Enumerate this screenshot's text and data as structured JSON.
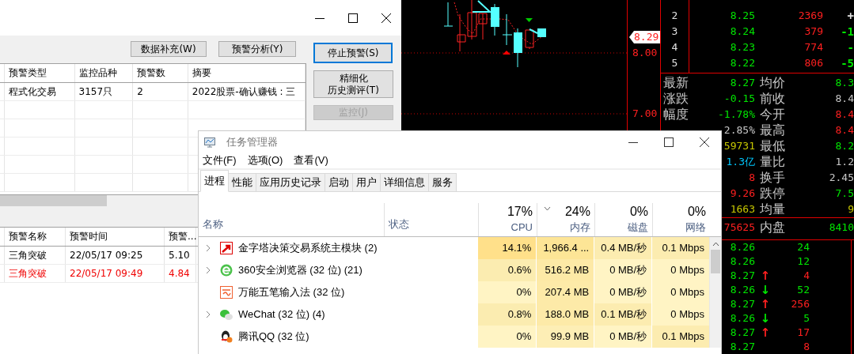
{
  "alert_window": {
    "toolbar_buttons": [
      "数据补充(W)",
      "预警分析(Y)"
    ],
    "strategy_table": {
      "columns": [
        "预警类型",
        "监控品种",
        "预警数",
        "摘要"
      ],
      "rows": [
        [
          "程式化交易",
          "3157只",
          "2",
          "2022股票-确认赚钱 : 三"
        ]
      ]
    },
    "side_buttons": [
      {
        "label": "停止预警(S)",
        "focused": true,
        "disabled": false
      },
      {
        "label": [
          "精细化",
          "历史测评(T)"
        ],
        "focused": false,
        "disabled": false
      },
      {
        "label": "监控(J)",
        "focused": false,
        "disabled": true
      }
    ],
    "alert_table": {
      "columns": [
        "预警名称",
        "预警时间",
        "预警..."
      ],
      "rows": [
        {
          "cells": [
            "三角突破",
            "22/05/17 09:25",
            "5.10"
          ],
          "highlighted": false
        },
        {
          "cells": [
            "三角突破",
            "22/05/17 09:49",
            "4.84"
          ],
          "highlighted": true
        }
      ]
    }
  },
  "stock_app": {
    "price_axis": [
      {
        "label": "8.29",
        "kind": "current"
      },
      {
        "label": "8.00",
        "kind": "tick"
      },
      {
        "label": "7.00",
        "kind": "tick"
      }
    ],
    "order_book": [
      {
        "index": "2",
        "price": "8.25",
        "volume": "2369",
        "change": {
          "text": "+",
          "color": "#e0e0e0"
        }
      },
      {
        "index": "3",
        "price": "8.24",
        "volume": "379",
        "change": {
          "text": "-1",
          "color": "#00e600"
        }
      },
      {
        "index": "4",
        "price": "8.23",
        "volume": "774",
        "change": {
          "text": "-",
          "color": "#00e600"
        }
      },
      {
        "index": "5",
        "price": "8.22",
        "volume": "806",
        "change": {
          "text": "-5",
          "color": "#00e600"
        }
      }
    ],
    "quote_stats": [
      {
        "label": "最新",
        "value": {
          "text": "8.27",
          "color": "#00e600"
        },
        "label_2": "均价",
        "value_2": {
          "text": "8.3",
          "color": "#00e600"
        }
      },
      {
        "label": "涨跌",
        "value": {
          "text": "-0.15",
          "color": "#00e600"
        },
        "label_2": "前收",
        "value_2": {
          "text": "8.4",
          "color": "#c8c8c8"
        }
      },
      {
        "label": "幅度",
        "value": {
          "text": "-1.78%",
          "color": "#00e600"
        },
        "label_2": "今开",
        "value_2": {
          "text": "8.4",
          "color": "#ff2020"
        }
      },
      {
        "value": {
          "text": "2.85%",
          "color": "#c8c8c8"
        },
        "label_2": "最高",
        "value_2": {
          "text": "8.4",
          "color": "#ff2020"
        }
      },
      {
        "value": {
          "text": "59731",
          "color": "#c8c800"
        },
        "label_2": "最低",
        "value_2": {
          "text": "8.2",
          "color": "#00e600"
        }
      },
      {
        "value": {
          "text": "1.3亿",
          "color": "#00c8ff"
        },
        "label_2": "量比",
        "value_2": {
          "text": "1.2",
          "color": "#c8c8c8"
        }
      },
      {
        "value": {
          "text": "8",
          "color": "#ff2020"
        },
        "label_2": "换手",
        "value_2": {
          "text": "2.45",
          "color": "#c8c8c8"
        }
      },
      {
        "value": {
          "text": "9.26",
          "color": "#ff2020"
        },
        "label_2": "跌停",
        "value_2": {
          "text": "7.5",
          "color": "#00e600"
        }
      },
      {
        "value": {
          "text": "1663",
          "color": "#c8c800"
        },
        "label_2": "均量",
        "value_2": {
          "text": "9",
          "color": "#c8c800"
        }
      }
    ],
    "volume_split": {
      "value": {
        "text": "75625",
        "color": "#ff2020"
      },
      "label_2": "内盘",
      "value_2": {
        "text": "8410",
        "color": "#00e600"
      }
    },
    "trade_ticks": [
      {
        "price": "8.26",
        "volume": {
          "text": "24",
          "color": "#00e600"
        }
      },
      {
        "price": "8.26",
        "volume": {
          "text": "12",
          "color": "#00e600"
        }
      },
      {
        "price": "8.27",
        "arrow": {
          "text": "↑",
          "color": "#ff2020"
        },
        "volume": {
          "text": "4",
          "color": "#ff2020"
        }
      },
      {
        "price": "8.26",
        "arrow": {
          "text": "↓",
          "color": "#00e600"
        },
        "volume": {
          "text": "52",
          "color": "#00e600"
        }
      },
      {
        "price": "8.27",
        "arrow": {
          "text": "↑",
          "color": "#ff2020"
        },
        "volume": {
          "text": "256",
          "color": "#ff2020"
        }
      },
      {
        "price": "8.26",
        "arrow": {
          "text": "↓",
          "color": "#00e600"
        },
        "volume": {
          "text": "5",
          "color": "#00e600"
        }
      },
      {
        "price": "8.27",
        "arrow": {
          "text": "↑",
          "color": "#ff2020"
        },
        "volume": {
          "text": "17",
          "color": "#ff2020"
        }
      },
      {
        "price": "8.27",
        "volume": {
          "text": "8",
          "color": "#ff2020"
        }
      }
    ]
  },
  "task_manager": {
    "title": "任务管理器",
    "menu": [
      "文件(F)",
      "选项(O)",
      "查看(V)"
    ],
    "tabs": [
      {
        "label": "进程",
        "selected": true
      },
      {
        "label": "性能",
        "selected": false
      },
      {
        "label": "应用历史记录",
        "selected": false
      },
      {
        "label": "启动",
        "selected": false
      },
      {
        "label": "用户",
        "selected": false
      },
      {
        "label": "详细信息",
        "selected": false
      },
      {
        "label": "服务",
        "selected": false
      }
    ],
    "columns": [
      {
        "label": "名称"
      },
      {
        "label": "状态"
      },
      {
        "percent": "17%",
        "label": "CPU",
        "sorted": false
      },
      {
        "percent": "24%",
        "label": "内存",
        "sorted": true
      },
      {
        "percent": "0%",
        "label": "磁盘",
        "sorted": false
      },
      {
        "percent": "0%",
        "label": "网络",
        "sorted": false
      }
    ],
    "processes": [
      {
        "name": "金字塔决策交易系统主模块 (2)",
        "expandable": true,
        "kind": "square-arrow",
        "cells": [
          {
            "text": "14.1%",
            "color": "#ffe08a"
          },
          {
            "text": "1,966.4 ...",
            "color": "#fde596"
          },
          {
            "text": "0.4 MB/秒",
            "color": "#fcecb0"
          },
          {
            "text": "0.1 Mbps",
            "color": "#fcecb0"
          }
        ]
      },
      {
        "name": "360安全浏览器 (32 位) (21)",
        "expandable": true,
        "kind": "letter-e",
        "cells": [
          {
            "text": "0.6%",
            "color": "#fbecb0"
          },
          {
            "text": "516.2 MB",
            "color": "#fde9a6"
          },
          {
            "text": "0 MB/秒",
            "color": "#fff4c4"
          },
          {
            "text": "0 Mbps",
            "color": "#fff4c4"
          }
        ]
      },
      {
        "name": "万能五笔输入法 (32 位)",
        "expandable": false,
        "kind": "wave",
        "cells": [
          {
            "text": "0%",
            "color": "#fff4c4"
          },
          {
            "text": "207.4 MB",
            "color": "#fdeaa8"
          },
          {
            "text": "0 MB/秒",
            "color": "#fff4c4"
          },
          {
            "text": "0 Mbps",
            "color": "#fff4c4"
          }
        ]
      },
      {
        "name": "WeChat (32 位) (4)",
        "expandable": true,
        "kind": "chat",
        "cells": [
          {
            "text": "0.8%",
            "color": "#fbecb0"
          },
          {
            "text": "188.0 MB",
            "color": "#fdeaa8"
          },
          {
            "text": "0.1 MB/秒",
            "color": "#fcecb0"
          },
          {
            "text": "0 Mbps",
            "color": "#fff4c4"
          }
        ]
      },
      {
        "name": "腾讯QQ (32 位)",
        "expandable": false,
        "kind": "penguin",
        "cells": [
          {
            "text": "0%",
            "color": "#fff4c4"
          },
          {
            "text": "99.9 MB",
            "color": "#fdeeb5"
          },
          {
            "text": "0 MB/秒",
            "color": "#fff4c4"
          },
          {
            "text": "0.1 Mbps",
            "color": "#fcecb0"
          }
        ]
      }
    ]
  }
}
